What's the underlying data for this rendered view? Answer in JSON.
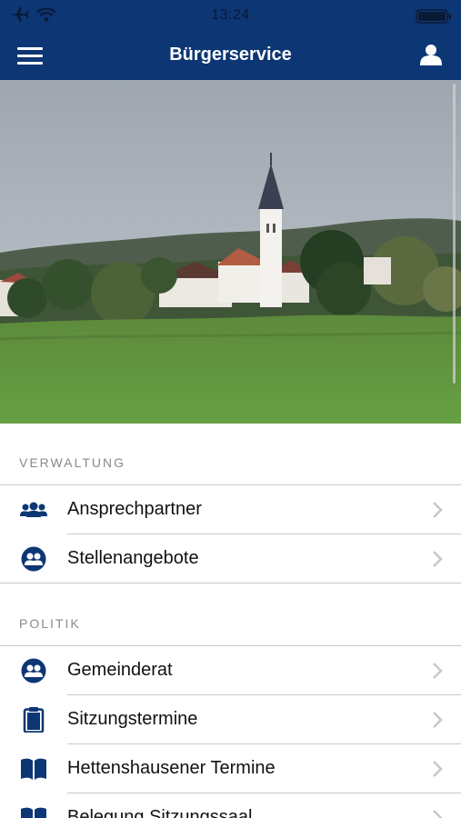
{
  "status_bar": {
    "time": "13:24"
  },
  "navbar": {
    "title": "Bürgerservice"
  },
  "sections": [
    {
      "header": "VERWALTUNG",
      "items": [
        {
          "label": "Ansprechpartner",
          "icon": "people-group-icon"
        },
        {
          "label": "Stellenangebote",
          "icon": "people-circle-icon"
        }
      ]
    },
    {
      "header": "POLITIK",
      "items": [
        {
          "label": "Gemeinderat",
          "icon": "people-circle-icon"
        },
        {
          "label": "Sitzungstermine",
          "icon": "clipboard-icon"
        },
        {
          "label": "Hettenshausener Termine",
          "icon": "book-icon"
        },
        {
          "label": "Belegung Sitzungssaal",
          "icon": "book-icon"
        }
      ]
    }
  ],
  "colors": {
    "navbar": "#0c3674",
    "icon": "#0c3674",
    "separator": "#c8c7cc",
    "section_header": "#8a8a8f"
  }
}
